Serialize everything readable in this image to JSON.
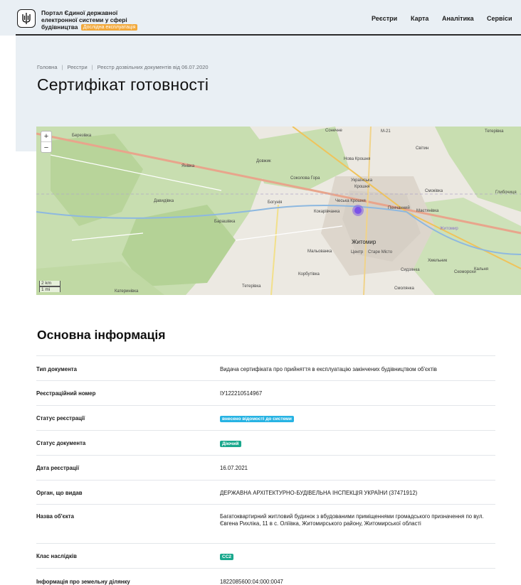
{
  "header": {
    "brand_title": "Портал Єдиної державної електронної системи у сфері будівництва",
    "beta_badge": "Дослідна експлуатація",
    "nav": [
      "Реєстри",
      "Карта",
      "Аналітика",
      "Сервіси"
    ]
  },
  "breadcrumb": [
    "Головна",
    "Реєстри",
    "Реєстр дозвільних документів від 06.07.2020"
  ],
  "page_title": "Сертифікат готовності",
  "map": {
    "zoom_in": "+",
    "zoom_out": "−",
    "scale_km": "2 km",
    "scale_mi": "1 mi",
    "labels": [
      "Березівка",
      "Сонечне",
      "М-21",
      "Нова Крошня",
      "Світин",
      "Тетерівка",
      "Янівка",
      "Довжик",
      "Соколова Гора",
      "Українська Крошня",
      "Смоківка",
      "Глибочиця",
      "Давидівка",
      "Богунія",
      "Кокарівчанка",
      "Чеська Крошня",
      "Пенчанний",
      "Маєтянівка",
      "Барашівка",
      "Житомир",
      "Центр",
      "Старе Місто",
      "Мальованка",
      "Корбутівка",
      "Смолянка",
      "Скоморохи",
      "Катеринівка",
      "Тетерівка",
      "Сидзянка",
      "Крошня",
      "Кальня"
    ]
  },
  "main": {
    "section_title": "Основна інформація",
    "rows": [
      {
        "label": "Тип документа",
        "value": "Видача сертифіката про прийняття в експлуатацію закінчених будівництвом об'єктів",
        "type": "text"
      },
      {
        "label": "Реєстраційний номер",
        "value": "IУ122210514967",
        "type": "text"
      },
      {
        "label": "Статус реєстрації",
        "value": "внесено відомості до системи",
        "type": "pill-blue"
      },
      {
        "label": "Статус документа",
        "value": "Діючий",
        "type": "pill-green"
      },
      {
        "label": "Дата реєстрації",
        "value": "16.07.2021",
        "type": "text"
      },
      {
        "label": "Орган, що видав",
        "value": "ДЕРЖАВНА АРХІТЕКТУРНО-БУДІВЕЛЬНА ІНСПЕКЦІЯ УКРАЇНИ (37471912)",
        "type": "text"
      },
      {
        "label": "Назва об'єкта",
        "value": "Багатоквартирний житловий будинок з вбудованими приміщеннями громадського призначення по вул. Євгена Рихліка, 11 в с. Оліївка, Житомирського району, Житомирської області",
        "type": "text"
      },
      {
        "label": "Клас наслідків",
        "value": "СС2",
        "type": "pill-green"
      },
      {
        "label": "Інформація про земельну ділянку",
        "value": "1822085600:04:000:0047",
        "type": "text"
      }
    ]
  },
  "colors": {
    "accent_blue": "#27b3e3",
    "accent_green": "#1aa88d",
    "beta": "#f2a93b",
    "map_marker": "#7b52e8"
  }
}
